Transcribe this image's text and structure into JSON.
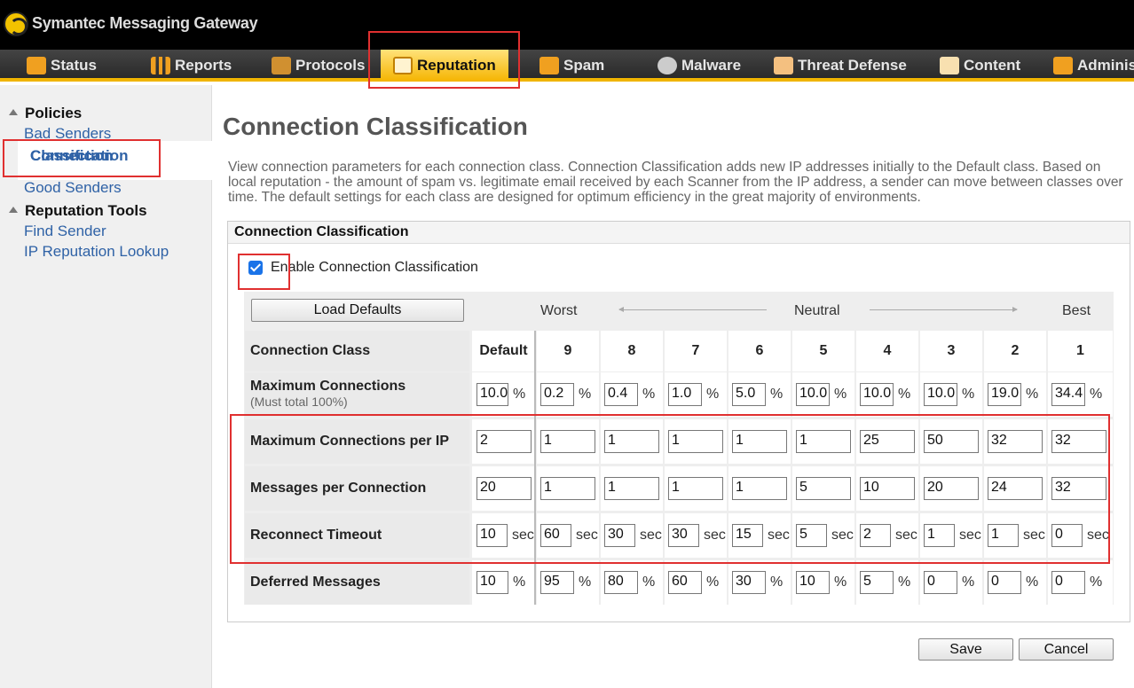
{
  "app": {
    "title": "Symantec Messaging Gateway"
  },
  "nav": {
    "items": [
      {
        "label": "Status",
        "icon": "status-icon"
      },
      {
        "label": "Reports",
        "icon": "reports-icon"
      },
      {
        "label": "Protocols",
        "icon": "protocols-icon"
      },
      {
        "label": "Reputation",
        "icon": "reputation-icon",
        "active": true
      },
      {
        "label": "Spam",
        "icon": "spam-icon"
      },
      {
        "label": "Malware",
        "icon": "malware-icon"
      },
      {
        "label": "Threat Defense",
        "icon": "threat-defense-icon"
      },
      {
        "label": "Content",
        "icon": "content-icon"
      },
      {
        "label": "Adminis",
        "icon": "administration-icon"
      }
    ]
  },
  "sidebar": {
    "policies": {
      "title": "Policies",
      "items": [
        "Bad Senders",
        "Connection Classification",
        "Good Senders"
      ],
      "active_line1": "Connection",
      "active_line2": "Classification"
    },
    "tools": {
      "title": "Reputation Tools",
      "items": [
        "Find Sender",
        "IP Reputation Lookup"
      ]
    }
  },
  "page": {
    "title": "Connection Classification",
    "description": "View connection parameters for each connection class. Connection Classification adds new IP addresses initially to the Default class. Based on local reputation - the amount of spam vs. legitimate email received by each Scanner from the IP address, a sender can move between classes over time. The default settings for each class are designed for optimum efficiency in the great majority of environments."
  },
  "panel": {
    "title": "Connection Classification",
    "enable_label": "Enable Connection Classification",
    "enable_checked": true,
    "load_defaults": "Load Defaults",
    "scale": {
      "worst": "Worst",
      "neutral": "Neutral",
      "best": "Best"
    },
    "columns": [
      "Default",
      "9",
      "8",
      "7",
      "6",
      "5",
      "4",
      "3",
      "2",
      "1"
    ],
    "rows": [
      {
        "label": "Connection Class"
      },
      {
        "label": "Maximum Connections",
        "sublabel": "(Must total 100%)",
        "unit": "%",
        "values": [
          "10.0",
          "0.2",
          "0.4",
          "1.0",
          "5.0",
          "10.0",
          "10.0",
          "10.0",
          "19.0",
          "34.4"
        ]
      },
      {
        "label": "Maximum Connections per IP",
        "unit": "",
        "values": [
          "2",
          "1",
          "1",
          "1",
          "1",
          "1",
          "25",
          "50",
          "32",
          "32"
        ]
      },
      {
        "label": "Messages per Connection",
        "unit": "",
        "values": [
          "20",
          "1",
          "1",
          "1",
          "1",
          "5",
          "10",
          "20",
          "24",
          "32"
        ]
      },
      {
        "label": "Reconnect Timeout",
        "unit": "sec",
        "values": [
          "10",
          "60",
          "30",
          "30",
          "15",
          "5",
          "2",
          "1",
          "1",
          "0"
        ]
      },
      {
        "label": "Deferred Messages",
        "unit": "%",
        "values": [
          "10",
          "95",
          "80",
          "60",
          "30",
          "10",
          "5",
          "0",
          "0",
          "0"
        ]
      }
    ]
  },
  "buttons": {
    "save": "Save",
    "cancel": "Cancel"
  },
  "colors": {
    "accent": "#f5b400",
    "link": "#2f62a6",
    "highlight": "#e03030"
  }
}
